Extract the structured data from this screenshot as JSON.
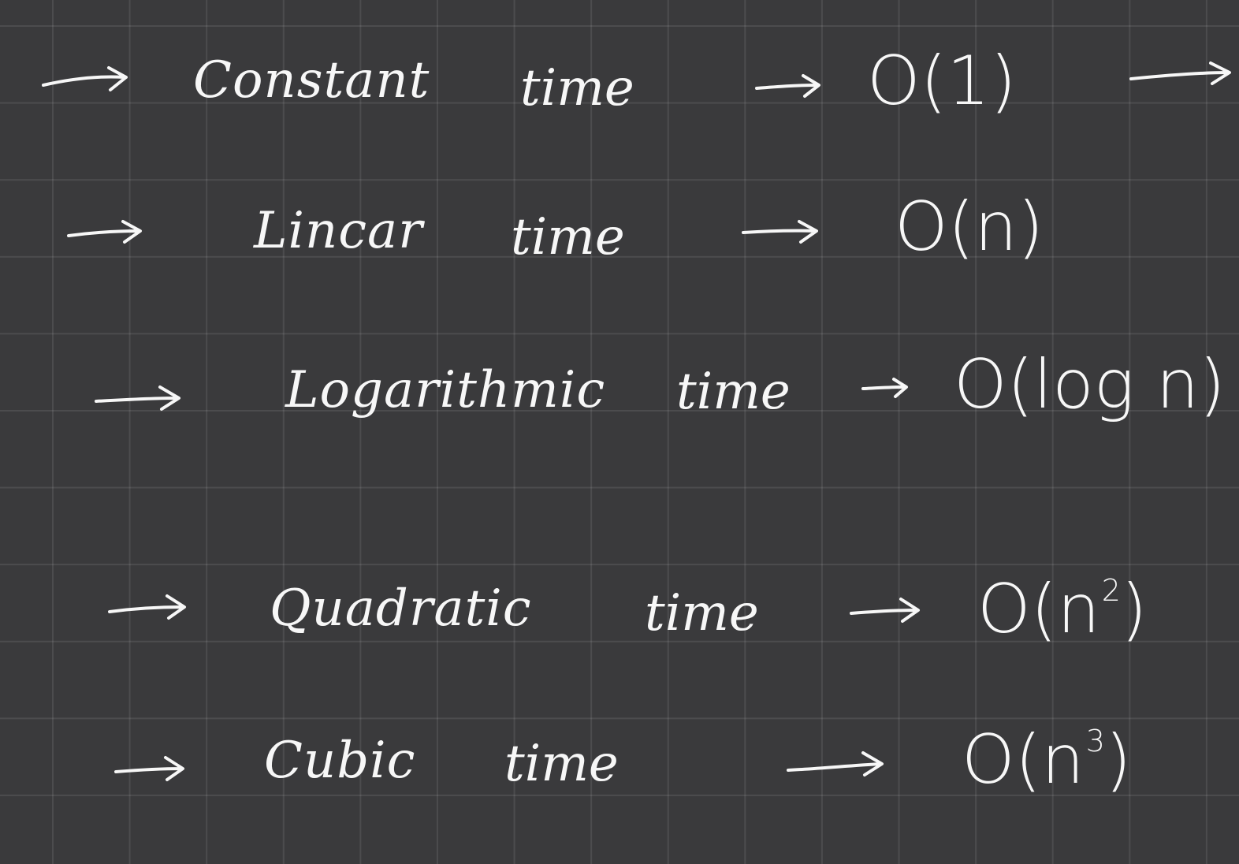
{
  "rows": [
    {
      "term": "Constant",
      "word": "time",
      "notation": "O(1)"
    },
    {
      "term": "Lincar",
      "word": "time",
      "notation": "O(n)"
    },
    {
      "term": "Logarithmic",
      "word": "time",
      "notation": "O(log n)"
    },
    {
      "term": "Quadratic",
      "word": "time",
      "notation_base": "O(n",
      "notation_exp": "2",
      "notation_close": ")"
    },
    {
      "term": "Cubic",
      "word": "time",
      "notation_base": "O(n",
      "notation_exp": "3",
      "notation_close": ")"
    }
  ],
  "colors": {
    "board": "#3a3a3c",
    "ink": "#f7f7f7"
  },
  "icons": [
    "arrow-right-icon"
  ]
}
